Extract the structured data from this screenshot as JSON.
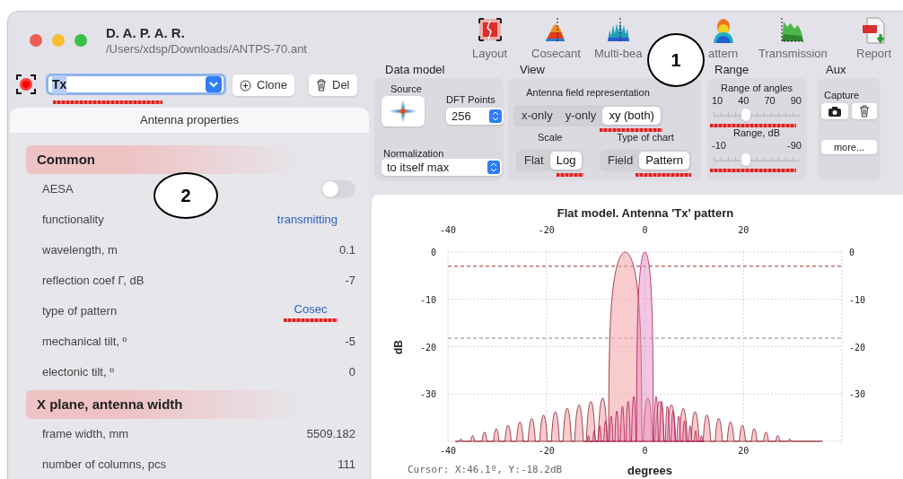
{
  "window": {
    "title": "D. A. P. A. R.",
    "path": "/Users/xdsp/Downloads/ANTPS-70.ant"
  },
  "toolbar": [
    {
      "kind": "layout",
      "label": "Layout"
    },
    {
      "kind": "cosecant",
      "label": "Cosecant"
    },
    {
      "kind": "multibeam",
      "label": "Multi-bea"
    },
    {
      "kind": "pattern",
      "label": "attern"
    },
    {
      "kind": "transmission",
      "label": "Transmission"
    },
    {
      "kind": "report",
      "label": "Report"
    }
  ],
  "callouts": [
    {
      "label": "1"
    },
    {
      "label": "2"
    }
  ],
  "antenna_selector": {
    "value": "Tx",
    "flagged": true,
    "buttons": [
      {
        "kind": "clone",
        "label": "Clone"
      },
      {
        "kind": "delete",
        "label": "Del"
      }
    ]
  },
  "properties": {
    "title": "Antenna properties",
    "sections": [
      {
        "title": "Common",
        "rows": [
          {
            "kind": "toggle",
            "label": "AESA",
            "on": false
          },
          {
            "kind": "link",
            "label": "functionality",
            "value": "transmitting"
          },
          {
            "kind": "value",
            "label": "wavelength, m",
            "value": "0.1"
          },
          {
            "kind": "value",
            "label": "reflection coef Γ, dB",
            "value": "-7"
          },
          {
            "kind": "link",
            "label": "type of pattern",
            "value": "Cosec",
            "flagged": true
          },
          {
            "kind": "value",
            "label": "mechanical tilt, º",
            "value": "-5"
          },
          {
            "kind": "value",
            "label": "electonic tilt, º",
            "value": "0"
          }
        ]
      },
      {
        "title": "X plane, antenna width",
        "rows": [
          {
            "kind": "value",
            "label": "frame width, mm",
            "value": "5509.182"
          },
          {
            "kind": "value",
            "label": "number of columns, pcs",
            "value": "111"
          }
        ]
      }
    ]
  },
  "data_model": {
    "title": "Data model",
    "source_label": "Source",
    "dft_label": "DFT Points",
    "dft_points": "256",
    "normalization_label": "Normalization",
    "normalization": "to itself max"
  },
  "view": {
    "title": "View",
    "representation": {
      "label": "Antenna field representation",
      "flagged": true,
      "options": [
        {
          "label": "x-only",
          "selected": false
        },
        {
          "label": "y-only",
          "selected": false
        },
        {
          "label": "xy (both)",
          "selected": true
        }
      ]
    },
    "scale": {
      "label": "Scale",
      "flagged": true,
      "options": [
        {
          "label": "Flat",
          "selected": false
        },
        {
          "label": "Log",
          "selected": true
        }
      ]
    },
    "chart_type": {
      "label": "Type of chart",
      "flagged": true,
      "options": [
        {
          "label": "Field",
          "selected": false
        },
        {
          "label": "Pattern",
          "selected": true
        }
      ]
    }
  },
  "range": {
    "title": "Range",
    "sliders": [
      {
        "label": "Range of angles",
        "ticks": [
          "10",
          "40",
          "70",
          "90"
        ],
        "level": 0.38,
        "flagged": true
      },
      {
        "label": "Range, dB",
        "ticks": [
          "-10",
          "-90"
        ],
        "level": 0.38,
        "flagged": true
      }
    ]
  },
  "aux": {
    "title": "Aux",
    "capture_label": "Capture",
    "more": "more..."
  },
  "chart": {
    "title": "Flat model. Antenna 'Tx' pattern",
    "top_ticks": [
      "-40",
      "-20",
      "0",
      "20"
    ],
    "bottom_ticks": [
      "-40",
      "-20",
      "0",
      "20"
    ],
    "left_ticks": [
      "0",
      "-10",
      "-20",
      "-30"
    ],
    "right_ticks": [
      "0",
      "-10",
      "-20",
      "-30"
    ],
    "ylabel": "dB",
    "xlabel": "degrees",
    "cursor": "Cursor: X:46.1º, Y:-18.2dB"
  }
}
